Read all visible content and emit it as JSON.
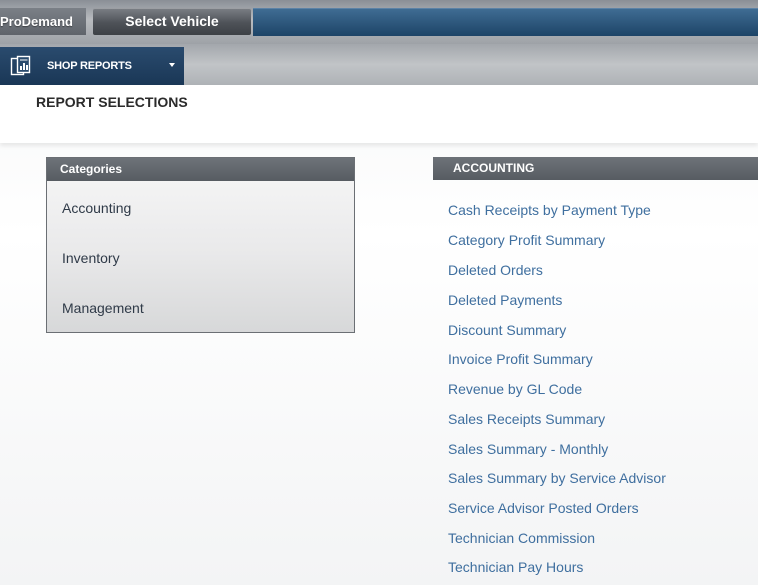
{
  "header": {
    "brand": "ProDemand",
    "select_vehicle": "Select Vehicle"
  },
  "nav": {
    "shop_reports": "SHOP REPORTS",
    "icon": "report-icon"
  },
  "page": {
    "title": "REPORT SELECTIONS"
  },
  "categories": {
    "heading": "Categories",
    "items": [
      "Accounting",
      "Inventory",
      "Management"
    ]
  },
  "reports": {
    "heading": "ACCOUNTING",
    "items": [
      "Cash Receipts by Payment Type",
      "Category Profit Summary",
      "Deleted Orders",
      "Deleted Payments",
      "Discount Summary",
      "Invoice Profit Summary",
      "Revenue by GL Code",
      "Sales Receipts Summary",
      "Sales Summary - Monthly",
      "Sales Summary by Service Advisor",
      "Service Advisor Posted Orders",
      "Technician Commission",
      "Technician Pay Hours"
    ]
  },
  "colors": {
    "link": "#3f6f9f",
    "nav_blue": "#1d4467",
    "panel_head": "#575c62"
  }
}
